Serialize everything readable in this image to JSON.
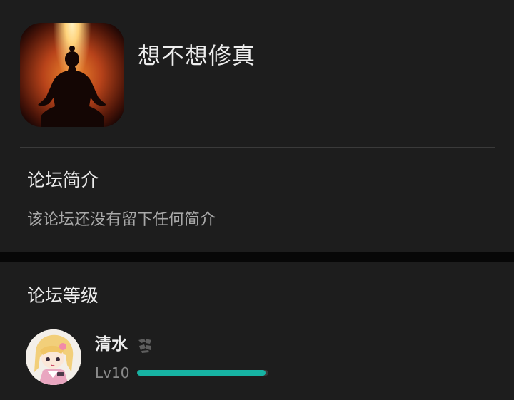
{
  "forum": {
    "title": "想不想修真",
    "icon": "meditating-figure-app-icon"
  },
  "intro": {
    "heading": "论坛简介",
    "text": "该论坛还没有留下任何简介"
  },
  "level": {
    "heading": "论坛等级",
    "user_name": "清水",
    "badge_icon": "ink-badge-icon",
    "level_label": "Lv10",
    "progress": 0.98,
    "bar_color": "#17b3a3"
  },
  "colors": {
    "background": "#1d1d1d",
    "separator": "#070707",
    "accent": "#17b3a3"
  }
}
